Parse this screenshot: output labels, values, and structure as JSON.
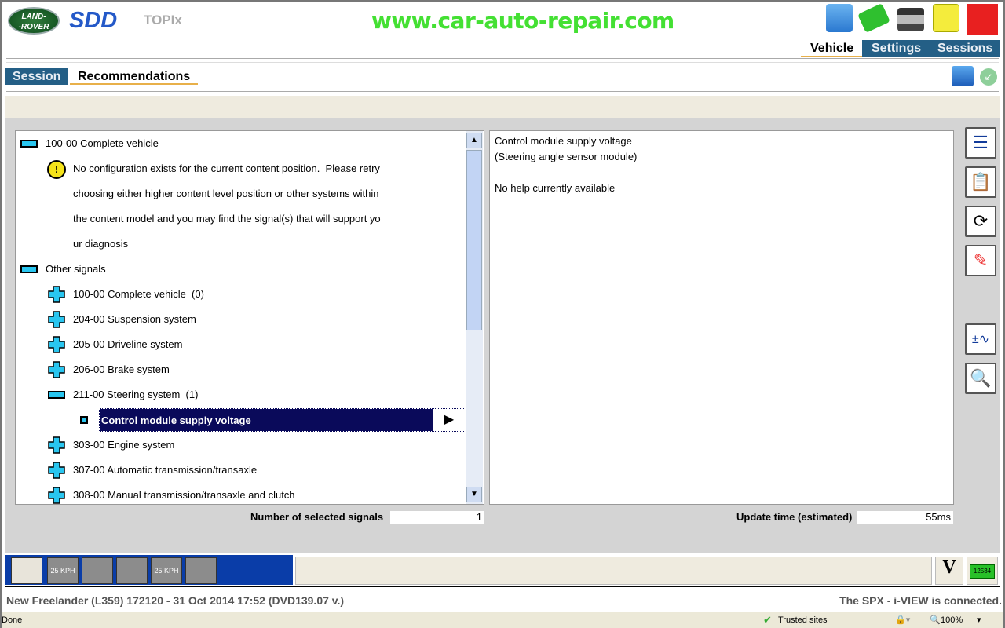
{
  "header": {
    "logo_text": "LAND-ROVER",
    "app": "SDD",
    "topix": "TOPIx",
    "watermark": "www.car-auto-repair.com"
  },
  "top_icons": [
    "oscilloscope-icon",
    "vehicle-icon",
    "battery-charger-icon",
    "notes-icon",
    "shutdown-icon"
  ],
  "main_tabs": [
    {
      "label": "Vehicle",
      "active": true
    },
    {
      "label": "Settings"
    },
    {
      "label": "Sessions"
    }
  ],
  "sub_tabs": [
    {
      "label": "Session"
    },
    {
      "label": "Recommendations",
      "active": true
    }
  ],
  "tree": {
    "root": "100-00 Complete vehicle",
    "warning_lines": [
      "No configuration exists for the current content position.  Please retry",
      "choosing either higher content level position or other systems within",
      "the content model and you may find the signal(s) that will support yo",
      "ur diagnosis"
    ],
    "other": "Other signals",
    "items": [
      "100-00 Complete vehicle  (0)",
      "204-00 Suspension system",
      "205-00 Driveline system",
      "206-00 Brake system",
      "211-00 Steering system  (1)"
    ],
    "selected": "Control module supply voltage",
    "items2": [
      "303-00 Engine system",
      "307-00 Automatic transmission/transaxle",
      "308-00 Manual transmission/transaxle and clutch"
    ]
  },
  "help": {
    "line1": "Control module supply voltage",
    "line2": "(Steering angle sensor module)",
    "line3": "No help currently available"
  },
  "footer": {
    "selected_label": "Number of selected signals",
    "selected_value": "1",
    "update_label": "Update time (estimated)",
    "update_value": "55ms"
  },
  "bottom_tools": [
    "25 KPH",
    "25 KPH"
  ],
  "status": {
    "vehicle": "New Freelander (L359) 172120 - 31 Oct 2014 17:52 (DVD139.07 v.)",
    "connection": "The SPX - i-VIEW is connected.",
    "battery": "12534"
  },
  "ie": {
    "done": "Done",
    "zone": "Trusted sites",
    "zoom": "100%"
  },
  "colors": {
    "tab_blue": "#245f86",
    "toolbar_blue": "#0a3da8",
    "selection": "#0a0a5a",
    "accent": "#e8b04a"
  }
}
